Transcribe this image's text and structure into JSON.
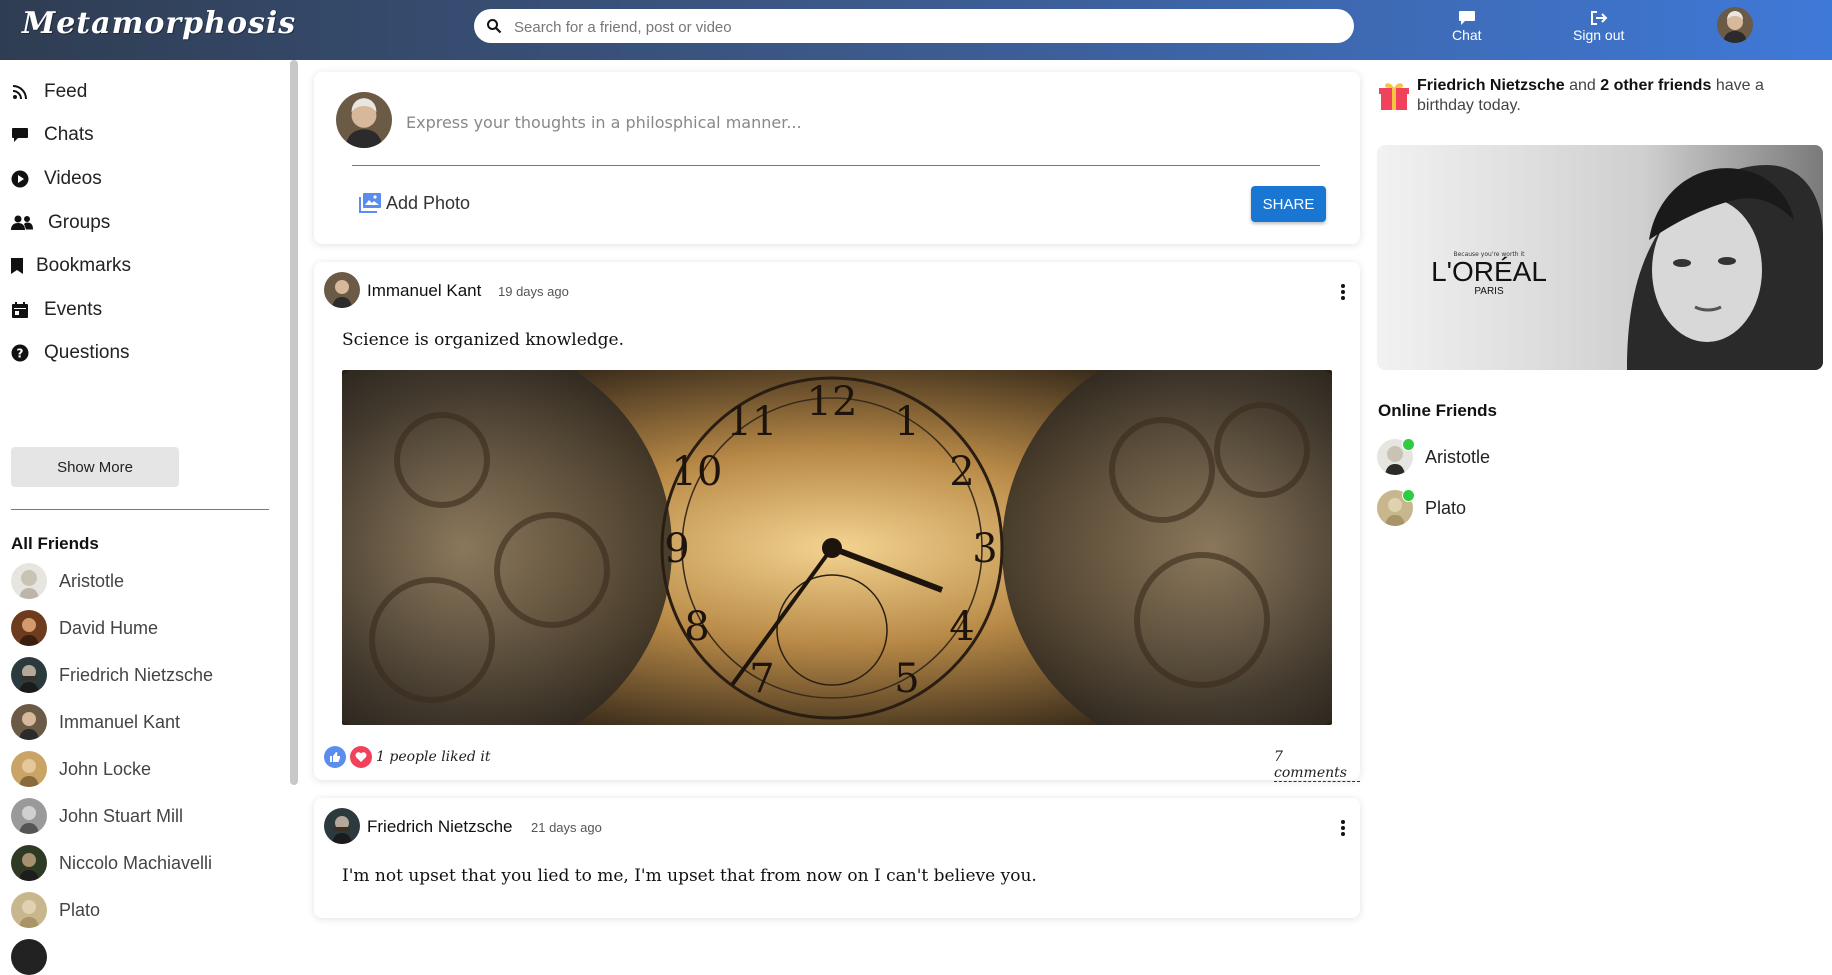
{
  "brand": "Metamorphosis",
  "search": {
    "placeholder": "Search for a friend, post or video"
  },
  "topnav": {
    "chat": "Chat",
    "signout": "Sign out"
  },
  "sidebar": {
    "items": [
      {
        "label": "Feed",
        "icon": "rss-icon"
      },
      {
        "label": "Chats",
        "icon": "chat-icon"
      },
      {
        "label": "Videos",
        "icon": "play-icon"
      },
      {
        "label": "Groups",
        "icon": "group-icon"
      },
      {
        "label": "Bookmarks",
        "icon": "bookmark-icon"
      },
      {
        "label": "Events",
        "icon": "calendar-icon"
      },
      {
        "label": "Questions",
        "icon": "help-icon"
      }
    ],
    "show_more": "Show More",
    "friends_title": "All Friends",
    "friends": [
      "Aristotle",
      "David Hume",
      "Friedrich Nietzsche",
      "Immanuel Kant",
      "John Locke",
      "John Stuart Mill",
      "Niccolo Machiavelli",
      "Plato"
    ]
  },
  "composer": {
    "placeholder": "Express your thoughts in a philosphical manner...",
    "add_photo": "Add Photo",
    "share": "SHARE"
  },
  "posts": [
    {
      "author": "Immanuel Kant",
      "time": "19 days ago",
      "text": "Science is organized knowledge.",
      "likes": "1 people liked it",
      "comments": "7 comments",
      "image": "vintage-clock-image"
    },
    {
      "author": "Friedrich Nietzsche",
      "time": "21 days ago",
      "text": "I'm not upset that you lied to me, I'm upset that from now on I can't believe you."
    }
  ],
  "birthday": {
    "name": "Friedrich Nietzsche",
    "and": "and",
    "others": "2 other friends",
    "suffix": "have a birthday today."
  },
  "ad": {
    "brand": "L'ORÉAL",
    "sub": "PARIS",
    "tagline": "Because you're worth it"
  },
  "online": {
    "title": "Online Friends",
    "friends": [
      "Aristotle",
      "Plato"
    ]
  },
  "colors": {
    "accent": "#1976d2",
    "online": "#2ecc40",
    "like": "#5b8def",
    "heart": "#f0425c"
  }
}
